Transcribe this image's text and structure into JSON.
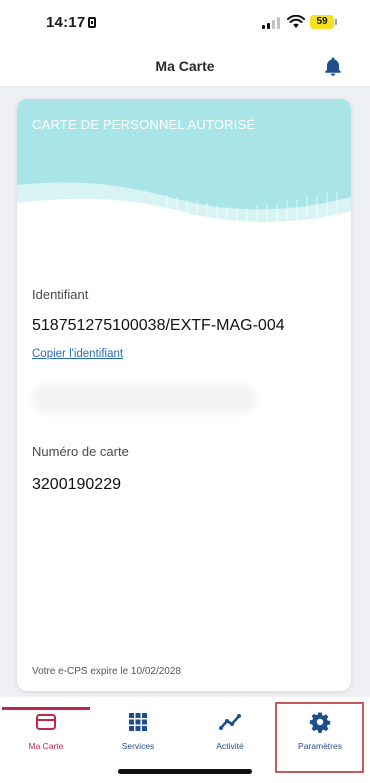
{
  "status_bar": {
    "time": "14:17",
    "battery": "59",
    "icons": [
      "sim-icon",
      "signal-icon",
      "wifi-icon",
      "battery-icon"
    ]
  },
  "header": {
    "title": "Ma Carte",
    "icon": "bell-icon"
  },
  "card": {
    "banner_title": "CARTE DE PERSONNEL AUTORISÉ",
    "banner_color": "#a9e4e6",
    "identifiant_label": "Identifiant",
    "identifiant_value": "518751275100038/EXTF-MAG-004",
    "copy_link": "Copier l'identifiant",
    "numero_label": "Numéro de carte",
    "numero_value": "3200190229",
    "expiry": "Votre e-CPS expire le 10/02/2028"
  },
  "bottom_nav": {
    "items": [
      {
        "label": "Ma Carte",
        "icon": "card-icon",
        "active": true
      },
      {
        "label": "Services",
        "icon": "grid-icon",
        "active": false
      },
      {
        "label": "Activité",
        "icon": "activity-icon",
        "active": false
      },
      {
        "label": "Paramètres",
        "icon": "gear-icon",
        "active": false,
        "highlighted": true
      }
    ],
    "active_color": "#c0284a",
    "inactive_color": "#1f4e8c"
  }
}
